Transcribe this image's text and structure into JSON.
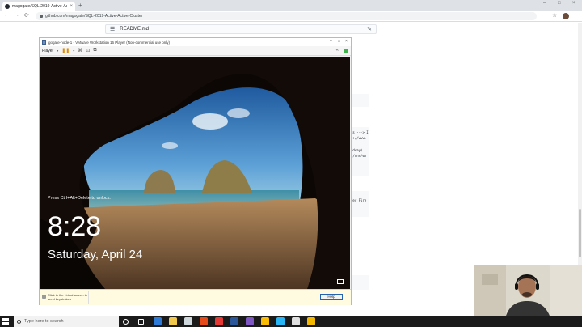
{
  "browser": {
    "tab_title": "magogate/SQL-2019-Active-Acti",
    "tab_close": "×",
    "new_tab": "+",
    "url": "github.com/magogate/SQL-2019-Active-Active-Cluster",
    "window_controls": [
      "–",
      "□",
      "×"
    ],
    "nav": [
      "←",
      "→",
      "⟳"
    ],
    "star": "☆",
    "menu": "⋮"
  },
  "github": {
    "lines_icon": "☰",
    "file_name": "README.md",
    "edit_icon": "✎",
    "code_snippets": [
      "<s ---> I",
      "c://www.",
      "ddway)",
      "//dns/wh",
      "der Fire"
    ]
  },
  "vmware": {
    "title": "gogate-node-1 - VMware Workstation 16 Player (Non-commercial use only)",
    "title_controls": [
      "–",
      "□",
      "×"
    ],
    "player_menu": "Player",
    "status_hint": "Click in the virtual screen to send keystrokes",
    "help_button": "Help"
  },
  "lockscreen": {
    "unlock_prompt": "Press Ctrl+Alt+Delete to unlock.",
    "time": "8:28",
    "date": "Saturday, April 24"
  },
  "taskbar": {
    "search_placeholder": "Type here to search",
    "pinned": [
      {
        "name": "cortana-icon",
        "color": "#ffffff"
      },
      {
        "name": "task-view-icon",
        "color": "#ffffff"
      },
      {
        "name": "edge-icon",
        "color": "#2d7bd6"
      },
      {
        "name": "file-explorer-icon",
        "color": "#f2c94c"
      },
      {
        "name": "store-icon",
        "color": "#cfd8dc"
      },
      {
        "name": "office-icon",
        "color": "#e64a19"
      },
      {
        "name": "security-icon",
        "color": "#e53935"
      },
      {
        "name": "word-icon",
        "color": "#2b579a"
      },
      {
        "name": "paint-icon",
        "color": "#7e57c2"
      },
      {
        "name": "chrome-icon",
        "color": "#fbbc05"
      },
      {
        "name": "photos-icon",
        "color": "#29b6f6"
      },
      {
        "name": "obs-icon",
        "color": "#e0e0e0"
      },
      {
        "name": "vmware-icon",
        "color": "#f5b800"
      }
    ]
  },
  "colors": {
    "chrome_frame": "#dee1e6",
    "taskbar": "#1b1b1b",
    "vm_status_bar": "#fffbe0",
    "help_border": "#2563b0"
  }
}
